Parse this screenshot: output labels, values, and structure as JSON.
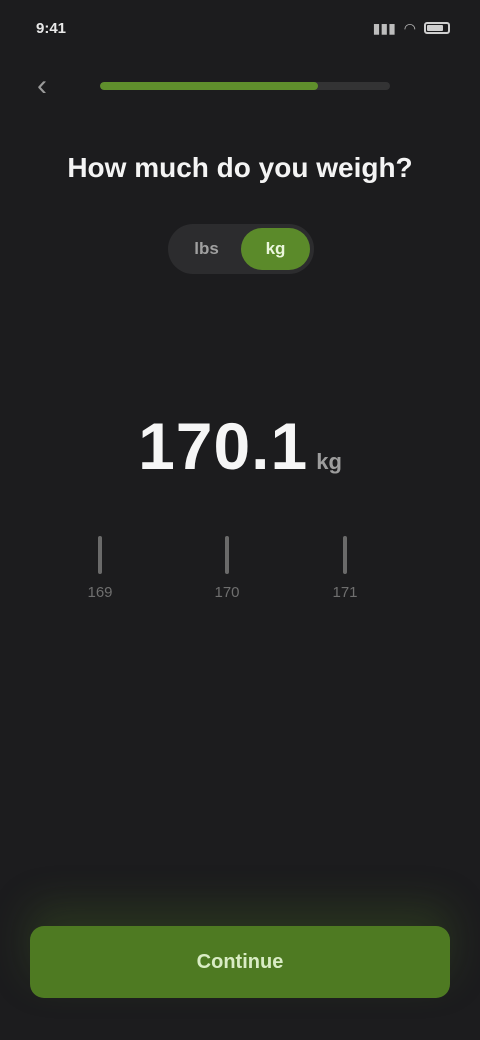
{
  "status_bar": {
    "time": "9:41",
    "signal_icon": "signal-icon",
    "wifi_icon": "wifi-icon",
    "battery_icon": "battery-icon",
    "battery_level": 0.8
  },
  "header": {
    "back_icon": "chevron-left-icon",
    "progress": 0.75
  },
  "question": "How much do you weigh?",
  "unit_toggle": {
    "options": [
      "lbs",
      "kg"
    ],
    "selected": "kg"
  },
  "weight": {
    "value": "170.1",
    "unit": "kg"
  },
  "ruler": {
    "labels": [
      "169",
      "170",
      "171"
    ]
  },
  "continue_label": "Continue",
  "colors": {
    "background": "#1c1c1e",
    "accent": "#5b8a2a",
    "button": "#4e7a22"
  }
}
